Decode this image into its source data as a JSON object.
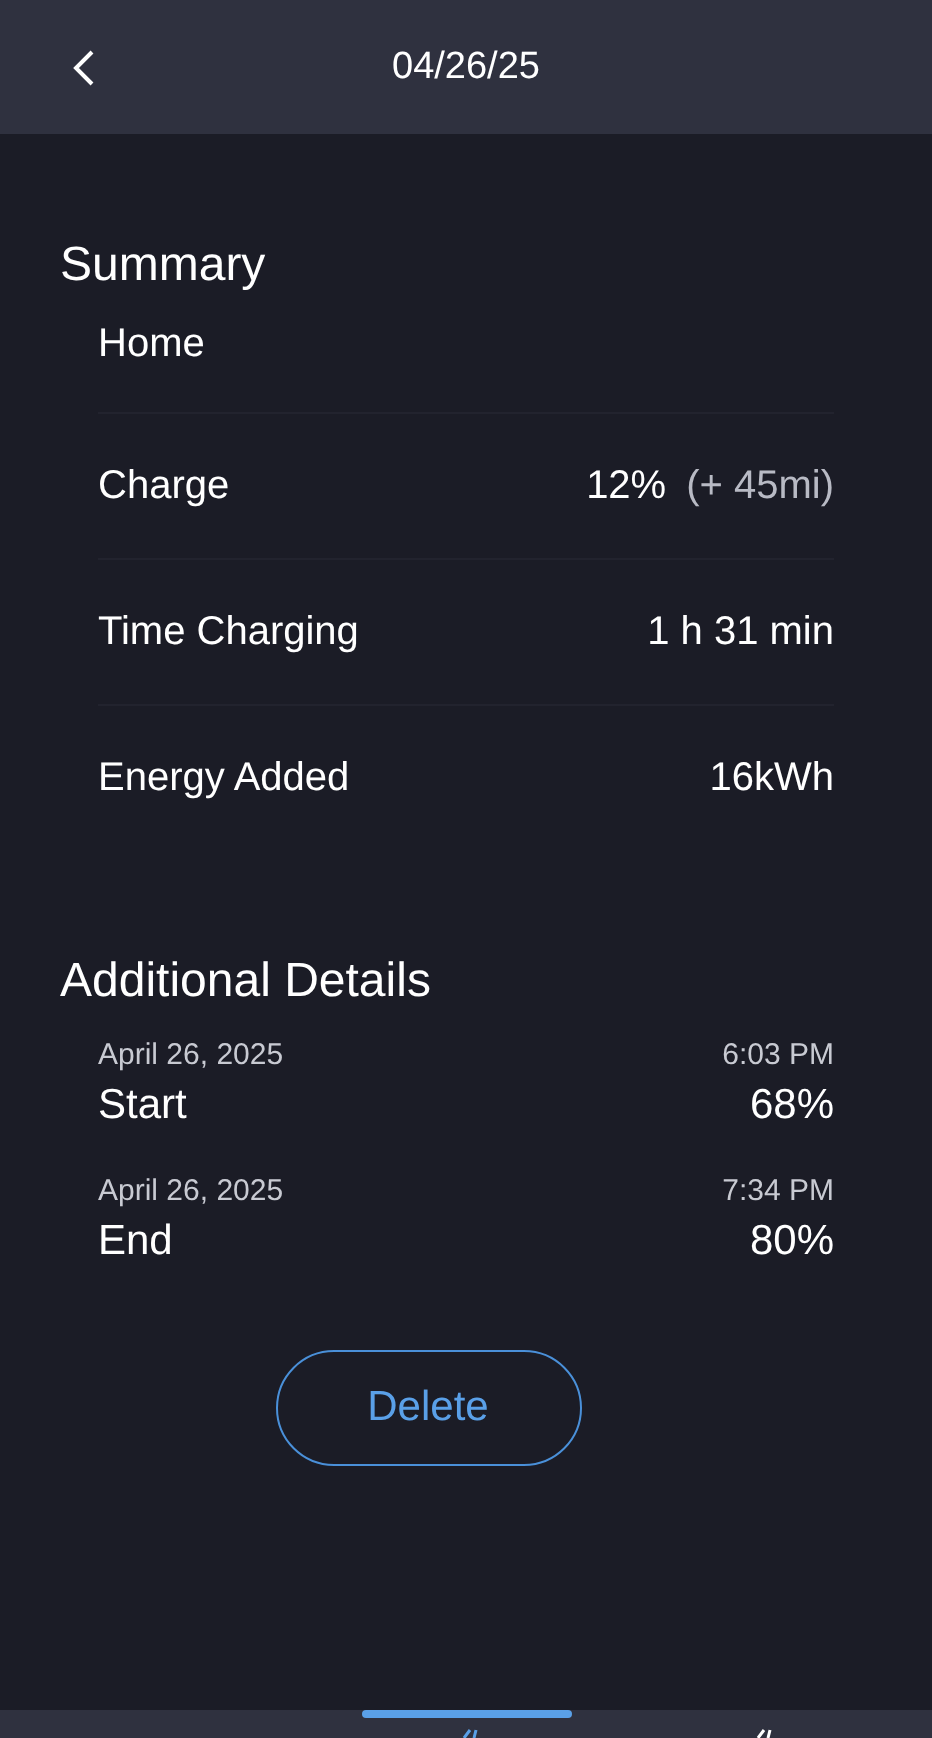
{
  "header": {
    "title": "04/26/25"
  },
  "summary": {
    "title": "Summary",
    "location": "Home",
    "rows": [
      {
        "label": "Charge",
        "value": "12%",
        "extra": "(+ 45mi)"
      },
      {
        "label": "Time Charging",
        "value": "1 h 31 min"
      },
      {
        "label": "Energy Added",
        "value": "16kWh"
      }
    ]
  },
  "additional": {
    "title": "Additional Details",
    "items": [
      {
        "date": "April 26, 2025",
        "time": "6:03 PM",
        "label": "Start",
        "value": "68%"
      },
      {
        "date": "April 26, 2025",
        "time": "7:34 PM",
        "label": "End",
        "value": "80%"
      }
    ]
  },
  "delete_button": "Delete",
  "bottom_nav": [
    {
      "selected": true
    },
    {
      "selected": false
    }
  ]
}
